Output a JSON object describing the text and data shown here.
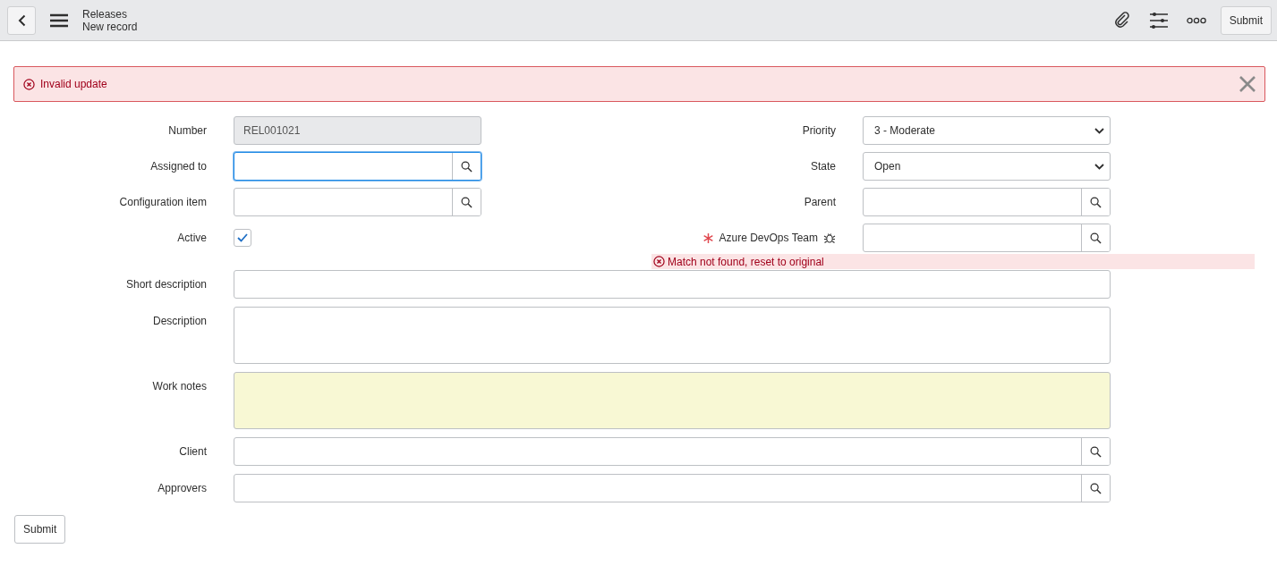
{
  "header": {
    "title": "Releases",
    "subtitle": "New record",
    "submit": "Submit"
  },
  "alert": {
    "message": "Invalid update"
  },
  "left_fields": [
    {
      "label": "Number",
      "kind": "readonly",
      "value": "REL001021"
    },
    {
      "label": "Assigned to",
      "kind": "lookup",
      "focused": true
    },
    {
      "label": "Configuration item",
      "kind": "lookup",
      "focused": false
    },
    {
      "label": "Active",
      "kind": "checkbox",
      "checked": true
    }
  ],
  "right_fields": [
    {
      "label": "Priority",
      "kind": "select",
      "value": "3 - Moderate"
    },
    {
      "label": "State",
      "kind": "select",
      "value": "Open"
    },
    {
      "label": "Parent",
      "kind": "lookup"
    },
    {
      "label": "Azure DevOps Team",
      "kind": "lookup",
      "required": true,
      "dependency_icon": true
    }
  ],
  "field_error": "Match not found, reset to original",
  "wide_fields": [
    {
      "label": "Short description",
      "kind": "text"
    },
    {
      "label": "Description",
      "kind": "textarea"
    },
    {
      "label": "Work notes",
      "kind": "journal"
    },
    {
      "label": "Client",
      "kind": "lookup"
    },
    {
      "label": "Approvers",
      "kind": "lookup"
    }
  ],
  "submit": "Submit"
}
